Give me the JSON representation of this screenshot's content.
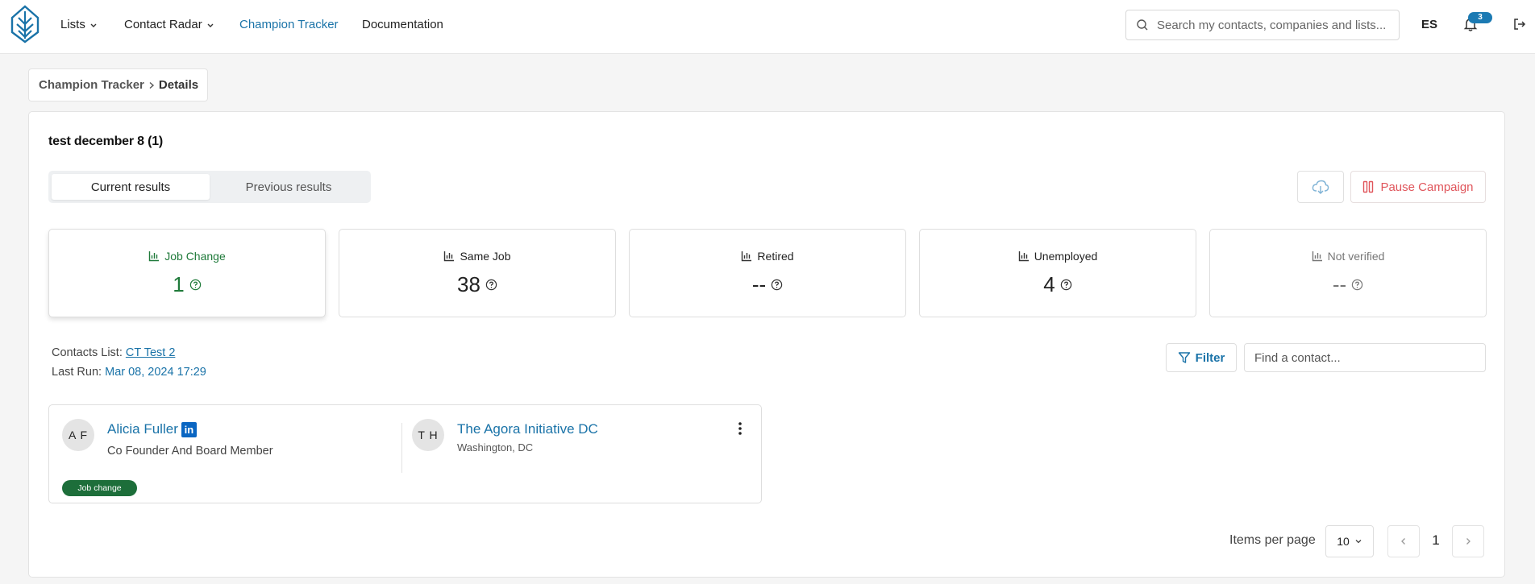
{
  "nav": {
    "items": [
      {
        "label": "Lists",
        "has_dropdown": true
      },
      {
        "label": "Contact Radar",
        "has_dropdown": true
      },
      {
        "label": "Champion Tracker",
        "active": true
      },
      {
        "label": "Documentation"
      }
    ],
    "search_placeholder": "Search my contacts, companies and lists...",
    "language": "ES",
    "notification_count": "3",
    "accent_color": "#1a73a8"
  },
  "breadcrumb": {
    "parent": "Champion Tracker",
    "current": "Details"
  },
  "campaign": {
    "title": "test december 8 (1)",
    "tabs": [
      {
        "label": "Current results",
        "active": true
      },
      {
        "label": "Previous results",
        "active": false
      }
    ],
    "pause_label": "Pause Campaign"
  },
  "stats": [
    {
      "label": "Job Change",
      "value": "1",
      "color": "#1f7a3a"
    },
    {
      "label": "Same Job",
      "value": "38"
    },
    {
      "label": "Retired",
      "value": "--"
    },
    {
      "label": "Unemployed",
      "value": "4"
    },
    {
      "label": "Not verified",
      "value": "--",
      "color": "#777777"
    }
  ],
  "meta": {
    "contacts_list_label": "Contacts List:",
    "contacts_list_value": "CT Test 2",
    "last_run_label": "Last Run:",
    "last_run_value": "Mar 08, 2024 17:29"
  },
  "filter": {
    "button_label": "Filter",
    "search_placeholder": "Find a contact..."
  },
  "contacts": [
    {
      "initials": "A F",
      "name": "Alicia Fuller",
      "title": "Co Founder And Board Member",
      "company_initials": "T H",
      "company": "The Agora Initiative DC",
      "location": "Washington, DC",
      "status": "Job change",
      "status_color": "#1d6e3a"
    }
  ],
  "pagination": {
    "items_per_page_label": "Items per page",
    "items_per_page": "10",
    "current_page": "1"
  }
}
